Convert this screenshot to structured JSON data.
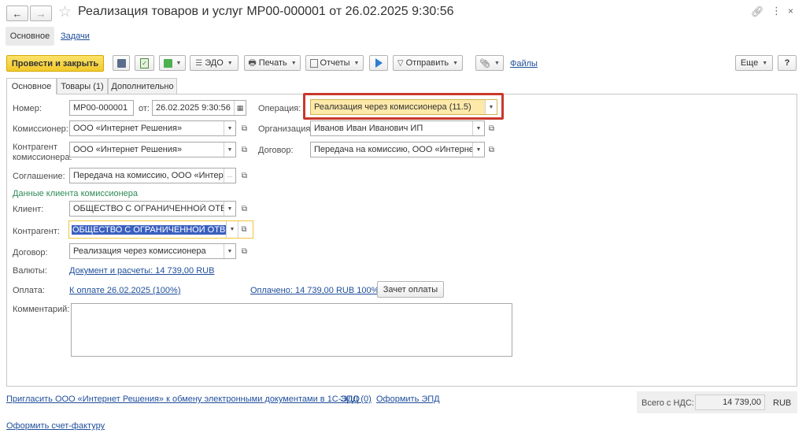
{
  "window": {
    "title": "Реализация товаров и услуг МР00-000001 от 26.02.2025 9:30:56",
    "nav_back_icon": "arrow-left-icon",
    "nav_forward_icon": "arrow-right-icon",
    "star_icon": "star-icon"
  },
  "section_nav": {
    "main": "Основное",
    "tasks": "Задачи"
  },
  "toolbar": {
    "post_close": "Провести и закрыть",
    "edo": "ЭДО",
    "print": "Печать",
    "reports": "Отчеты",
    "send": "Отправить",
    "files": "Файлы",
    "more": "Еще",
    "help": "?"
  },
  "tabs": {
    "main": "Основное",
    "goods": "Товары (1)",
    "extra": "Дополнительно"
  },
  "form": {
    "number_label": "Номер:",
    "number_value": "МР00-000001",
    "date_label": "от:",
    "date_value": "26.02.2025  9:30:56",
    "operation_label": "Операция:",
    "operation_value": "Реализация через комиссионера (11.5)",
    "commissioner_label": "Комиссионер:",
    "commissioner_value": "ООО «Интернет Решения»",
    "organization_label": "Организация:",
    "organization_value": "Иванов Иван Иванович ИП",
    "counterparty_comm_label_1": "Контрагент",
    "counterparty_comm_label_2": "комиссионера:",
    "counterparty_comm_value": "ООО «Интернет Решения»",
    "contract_label": "Договор:",
    "contract_value": "Передача на комиссию, ООО «Интернет I",
    "agreement_label": "Соглашение:",
    "agreement_value": "Передача на комиссию, ООО «Интерне",
    "client_section": "Данные клиента комиссионера",
    "client_label": "Клиент:",
    "client_value": "ОБЩЕСТВО С ОГРАНИЧЕННОЙ ОТВЕТ",
    "counterparty_label": "Контрагент:",
    "counterparty_value": "ОБЩЕСТВО С ОГРАНИЧЕННОЙ ОТВЕ",
    "client_contract_label": "Договор:",
    "client_contract_value": "Реализация через комиссионера",
    "currency_label": "Валюты:",
    "currency_link": "Документ и расчеты: 14 739,00 RUB",
    "payment_label": "Оплата:",
    "payment_link": "К оплате 26.02.2025 (100%)",
    "paid_link": "Оплачено: 14 739,00 RUB 100%",
    "offset_button": "Зачет оплаты",
    "comment_label": "Комментарий:",
    "comment_value": ""
  },
  "footer": {
    "invite_link": "Пригласить ООО «Интернет Решения» к обмену электронными документами в 1С-ЭДО",
    "epd_link": "ЭПД (0)",
    "make_epd_link": "Оформить ЭПД",
    "invoice_link": "Оформить счет-фактуру",
    "total_label": "Всего с НДС:",
    "total_value": "14 739,00",
    "currency": "RUB"
  },
  "colors": {
    "accent_yellow": "#f7d33a",
    "highlight_red": "#c9382b",
    "link_blue": "#1f4e9b",
    "section_green": "#2e8b57",
    "selection_blue": "#3a5fbf"
  }
}
